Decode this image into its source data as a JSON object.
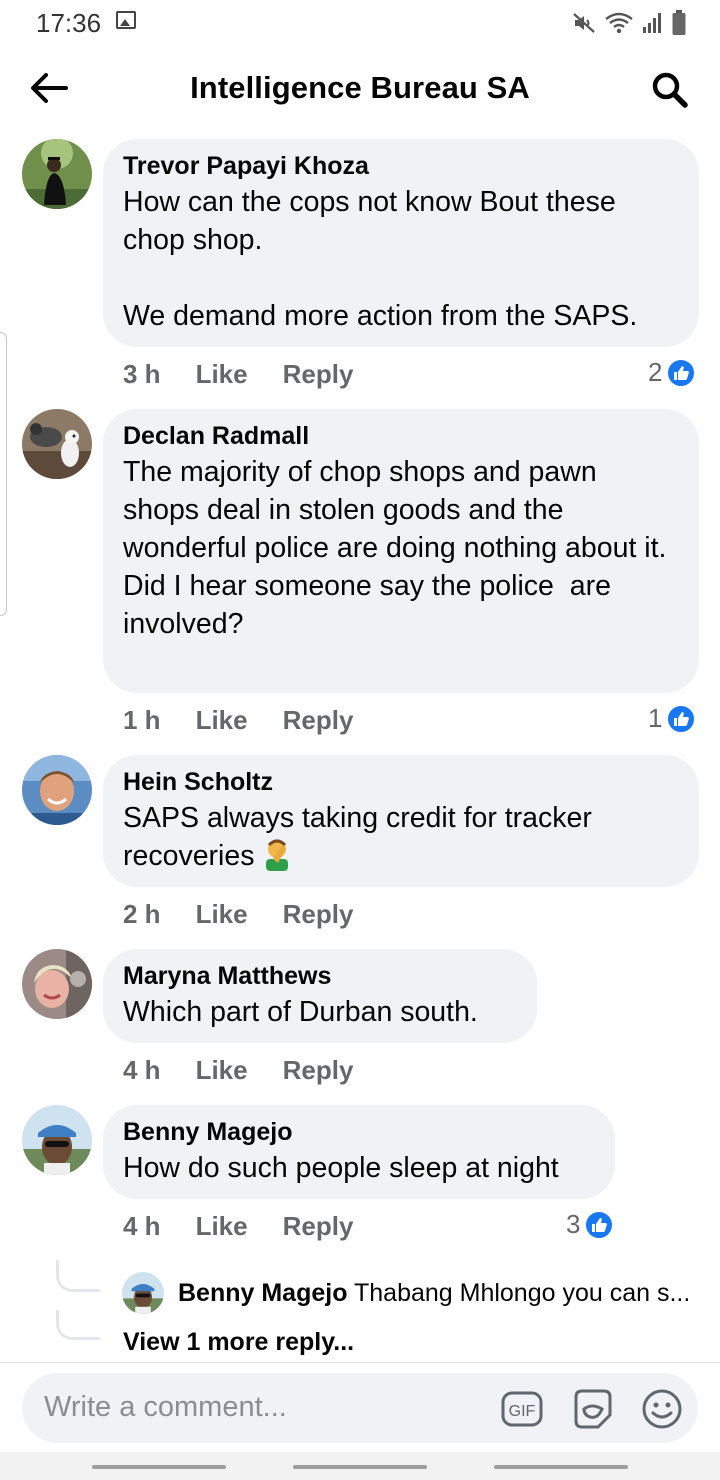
{
  "status_bar": {
    "time": "17:36",
    "icons": [
      "image-icon",
      "mute-icon",
      "wifi-icon",
      "signal-icon",
      "battery-icon"
    ]
  },
  "header": {
    "title": "Intelligence Bureau SA",
    "back_icon": "back-arrow-icon",
    "search_icon": "search-icon"
  },
  "comments": [
    {
      "author": "Trevor Papayi Khoza",
      "text": "How can the cops not know Bout these chop shop.\n\nWe demand more action from the SAPS.",
      "time": "3 h",
      "like_label": "Like",
      "reply_label": "Reply",
      "reactions": "2"
    },
    {
      "author": "Declan Radmall",
      "text": "The majority of chop shops and pawn shops deal in stolen goods and the wonderful police are doing nothing about it.\nDid I hear someone say the police  are involved?",
      "time": "1 h",
      "like_label": "Like",
      "reply_label": "Reply",
      "reactions": "1"
    },
    {
      "author": "Hein Scholtz",
      "text": "SAPS always taking credit for tracker recoveries",
      "emoji": "man-facepalming-emoji",
      "time": "2 h",
      "like_label": "Like",
      "reply_label": "Reply"
    },
    {
      "author": "Maryna Matthews",
      "text": "Which part of Durban south.",
      "time": "4 h",
      "like_label": "Like",
      "reply_label": "Reply"
    },
    {
      "author": "Benny Magejo",
      "text": "How do such people sleep at night",
      "time": "4 h",
      "like_label": "Like",
      "reply_label": "Reply",
      "reactions": "3"
    }
  ],
  "reply_preview": {
    "author": "Benny Magejo",
    "text": "Thabang Mhlongo you can s..."
  },
  "view_more": "View 1 more reply...",
  "composer": {
    "placeholder": "Write a comment...",
    "gif_label": "GIF",
    "icons": [
      "gif-icon",
      "sticker-icon",
      "emoji-icon"
    ]
  },
  "colors": {
    "accent": "#1877f2",
    "bubble": "#f0f2f5",
    "secondary_text": "#65676b"
  }
}
